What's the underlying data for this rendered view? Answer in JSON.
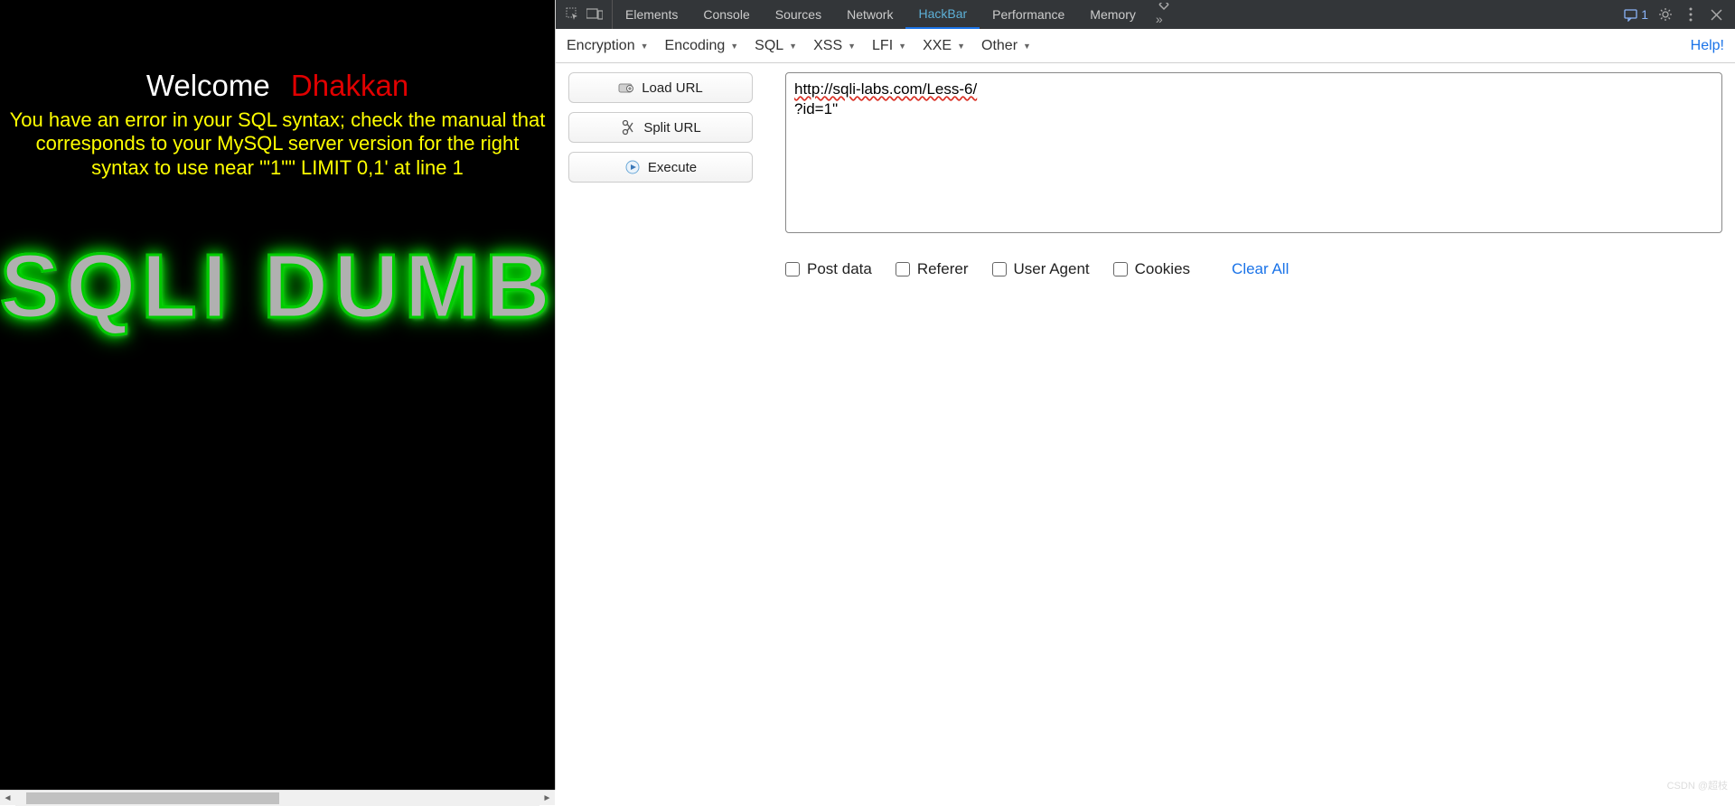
{
  "webpage": {
    "welcome": "Welcome",
    "dhakkan": "Dhakkan",
    "error": "You have an error in your SQL syntax; check the manual that corresponds to your MySQL server version for the right syntax to use near '\"1\"\" LIMIT 0,1' at line 1",
    "banner": "SQLI DUMB"
  },
  "devtools": {
    "tabs": [
      "Elements",
      "Console",
      "Sources",
      "Network",
      "HackBar",
      "Performance",
      "Memory"
    ],
    "active_tab": "HackBar",
    "message_count": "1"
  },
  "hackbar": {
    "dropdowns": [
      "Encryption",
      "Encoding",
      "SQL",
      "XSS",
      "LFI",
      "XXE",
      "Other"
    ],
    "help": "Help!",
    "buttons": {
      "load_url": "Load URL",
      "split_url": "Split URL",
      "execute": "Execute"
    },
    "url_line1": "http://sqli-labs.com/Less-6/",
    "url_line2": "?id=1\"",
    "checkboxes": [
      "Post data",
      "Referer",
      "User Agent",
      "Cookies"
    ],
    "clear_all": "Clear All"
  },
  "watermark": "CSDN @超枝"
}
